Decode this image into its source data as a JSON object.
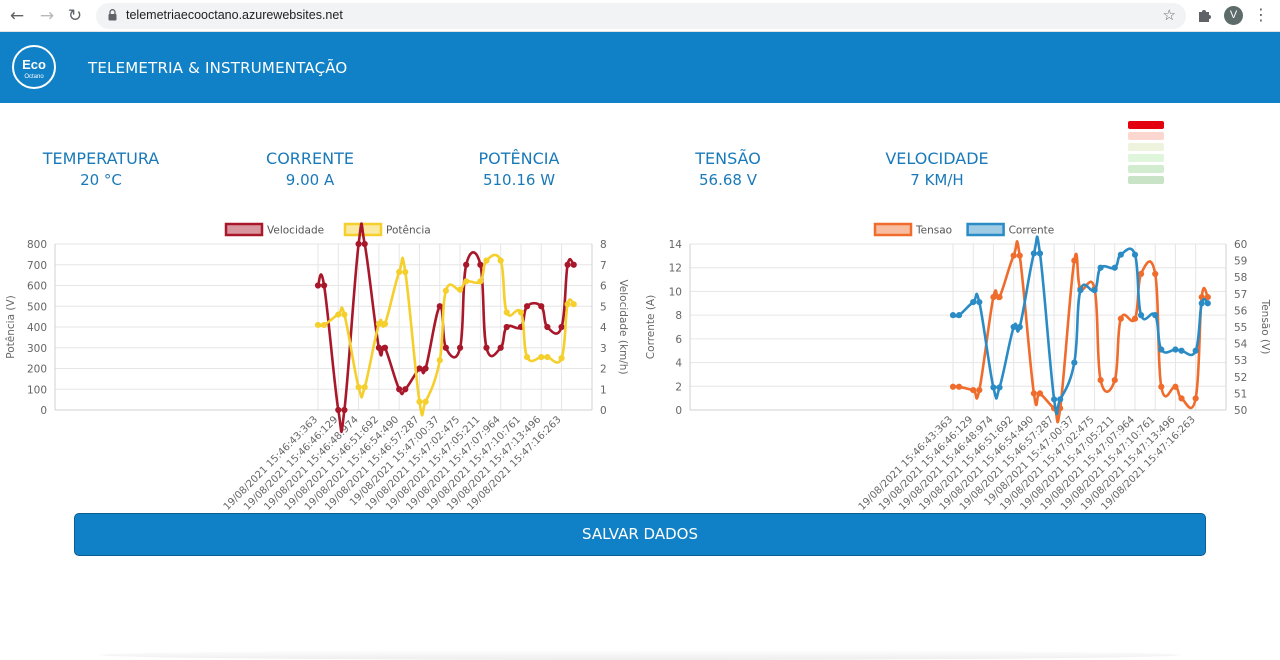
{
  "browser": {
    "url": "telemetriaecooctano.azurewebsites.net",
    "profile_initial": "V"
  },
  "header": {
    "logo_text": "Eco",
    "logo_sub": "Octano",
    "title": "TELEMETRIA & INSTRUMENTAÇÃO"
  },
  "metrics": [
    {
      "label": "TEMPERATURA",
      "value": "20 °C"
    },
    {
      "label": "CORRENTE",
      "value": "9.00 A"
    },
    {
      "label": "POTÊNCIA",
      "value": "510.16 W"
    },
    {
      "label": "TENSÃO",
      "value": "56.68 V"
    },
    {
      "label": "VELOCIDADE",
      "value": "7 KM/H"
    }
  ],
  "level_colors": [
    "#e3000f",
    "#fbd7cf",
    "#eef3dd",
    "#dff6dd",
    "#d2eccf",
    "#c9e3c7"
  ],
  "save_button": "SALVAR DADOS",
  "colors": {
    "accent": "#1081c6",
    "metric_text": "#1a7ab9",
    "velocidade": "#a8182a",
    "potencia": "#f5cf2c",
    "tensao": "#ef6c2c",
    "corrente": "#2b8bc5"
  },
  "chart_data": [
    {
      "type": "line",
      "categories": [
        "19/08/2021 15:46:43:363",
        "19/08/2021 15:46:46:129",
        "19/08/2021 15:46:48:974",
        "19/08/2021 15:46:51:692",
        "19/08/2021 15:46:54:490",
        "19/08/2021 15:46:57:287",
        "19/08/2021 15:47:00:37",
        "19/08/2021 15:47:02:475",
        "19/08/2021 15:47:05:211",
        "19/08/2021 15:47:07:964",
        "19/08/2021 15:47:10:761",
        "19/08/2021 15:47:13:496",
        "19/08/2021 15:47:16:263"
      ],
      "x_range": [
        0,
        13.5
      ],
      "x_values": [
        0,
        0.3,
        1,
        1.3,
        2,
        2.3,
        3,
        3.3,
        4,
        4.3,
        5,
        5.3,
        6,
        6.3,
        7,
        7.3,
        8,
        8.3,
        9,
        9.3,
        10,
        10.3,
        11,
        11.3,
        12,
        12.3,
        12.6
      ],
      "series": [
        {
          "name": "Velocidade",
          "axis": "right",
          "color": "#a8182a",
          "values": [
            6,
            6,
            0,
            0,
            8,
            8,
            3,
            3,
            1,
            1,
            2,
            2,
            5,
            3,
            3,
            7,
            7,
            3,
            3,
            4,
            4,
            5,
            5,
            4,
            4,
            7,
            7
          ]
        },
        {
          "name": "Potência",
          "axis": "left",
          "color": "#f5cf2c",
          "values": [
            410,
            410,
            460,
            460,
            110,
            110,
            415,
            415,
            665,
            665,
            40,
            40,
            240,
            575,
            580,
            620,
            620,
            720,
            720,
            470,
            470,
            255,
            255,
            255,
            250,
            510,
            510
          ]
        }
      ],
      "y_left": {
        "label": "Potência (V)",
        "range": [
          0,
          800
        ],
        "ticks": [
          0,
          100,
          200,
          300,
          400,
          500,
          600,
          700,
          800
        ]
      },
      "y_right": {
        "label": "Velocidade (km/h)",
        "range": [
          0,
          8
        ],
        "ticks": [
          0,
          1,
          2,
          3,
          4,
          5,
          6,
          7,
          8
        ]
      },
      "legend_position": "top-center",
      "grid": true
    },
    {
      "type": "line",
      "categories": [
        "19/08/2021 15:46:43:363",
        "19/08/2021 15:46:46:129",
        "19/08/2021 15:46:48:974",
        "19/08/2021 15:46:51:692",
        "19/08/2021 15:46:54:490",
        "19/08/2021 15:46:57:287",
        "19/08/2021 15:47:00:37",
        "19/08/2021 15:47:02:475",
        "19/08/2021 15:47:05:211",
        "19/08/2021 15:47:07:964",
        "19/08/2021 15:47:10:761",
        "19/08/2021 15:47:13:496",
        "19/08/2021 15:47:16:263"
      ],
      "x_range": [
        0,
        13.5
      ],
      "x_values": [
        0,
        0.3,
        1,
        1.3,
        2,
        2.3,
        3,
        3.3,
        4,
        4.3,
        5,
        5.3,
        6,
        6.3,
        7,
        7.3,
        8,
        8.3,
        9,
        9.3,
        10,
        10.3,
        11,
        11.3,
        12,
        12.3,
        12.6
      ],
      "series": [
        {
          "name": "Tensao",
          "axis": "right",
          "color": "#ef6c2c",
          "values": [
            51.4,
            51.4,
            51.2,
            51.2,
            56.8,
            56.8,
            59.3,
            59.3,
            51.0,
            51.0,
            50.1,
            50.1,
            59.0,
            57.3,
            57.3,
            51.8,
            51.8,
            55.5,
            55.5,
            58.2,
            58.2,
            51.4,
            51.4,
            50.7,
            50.7,
            56.8,
            56.8
          ]
        },
        {
          "name": "Corrente",
          "axis": "left",
          "color": "#2b8bc5",
          "values": [
            8,
            8,
            9.1,
            9.1,
            1.9,
            1.9,
            7.0,
            7.0,
            13.2,
            13.2,
            0.9,
            0.9,
            4.0,
            10.1,
            10.1,
            12.0,
            12.0,
            13.1,
            13.1,
            8.0,
            8.0,
            5.1,
            5.1,
            5.0,
            5.0,
            9.0,
            9.0
          ]
        }
      ],
      "y_left": {
        "label": "Corrente (A)",
        "range": [
          0,
          14
        ],
        "ticks": [
          0,
          2,
          4,
          6,
          8,
          10,
          12,
          14
        ]
      },
      "y_right": {
        "label": "Tensão (V)",
        "range": [
          50,
          60
        ],
        "ticks": [
          50,
          51,
          52,
          53,
          54,
          55,
          56,
          57,
          58,
          59,
          60
        ]
      },
      "legend_position": "top-center",
      "grid": true
    }
  ]
}
